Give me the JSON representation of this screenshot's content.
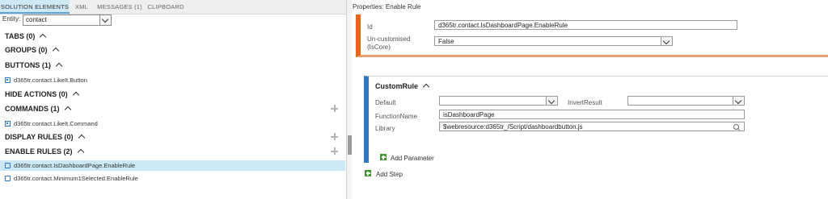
{
  "tabs": [
    "SOLUTION ELEMENTS",
    "XML",
    "MESSAGES (1)",
    "CLIPBOARD"
  ],
  "entity": {
    "label": "Entity:",
    "value": "contact"
  },
  "sections": {
    "tabs": "TABS (0)",
    "groups": "GROUPS (0)",
    "buttons": "BUTTONS (1)",
    "hide_actions": "HIDE ACTIONS (0)",
    "commands": "COMMANDS (1)",
    "display_rules": "DISPLAY RULES (0)",
    "enable_rules": "ENABLE RULES (2)"
  },
  "items": {
    "button": "d365tr.contact.LikeIt.Button",
    "command": "d365tr.contact.LikeIt.Command",
    "enable_rule_1": "d365tr.contact.IsDashboardPage.EnableRule",
    "enable_rule_2": "d365tr.contact.Minimum1Selected.EnableRule"
  },
  "properties": {
    "title": "Properties: Enable Rule",
    "id_label": "Id",
    "id_value": "d365tr.contact.IsDashboardPage.EnableRule",
    "uncustomised_label_1": "Un-customised",
    "uncustomised_label_2": "(IsCore)",
    "uncustomised_value": "False"
  },
  "custom_rule": {
    "title": "CustomRule",
    "default_label": "Default",
    "default_value": "",
    "invert_label": "InvertResult",
    "invert_value": "",
    "function_label": "FunctionName",
    "function_value": "isDashboardPage",
    "library_label": "Library",
    "library_value": "$webresource:d365tr_/Script/dashboardbutton.js",
    "add_parameter": "Add Parameter"
  },
  "add_step": "Add Step",
  "colors": {
    "orange_accent": "#e8641b",
    "blue_accent": "#2b79c2",
    "selection": "#cbe8f6",
    "green": "#3f9a2f"
  }
}
